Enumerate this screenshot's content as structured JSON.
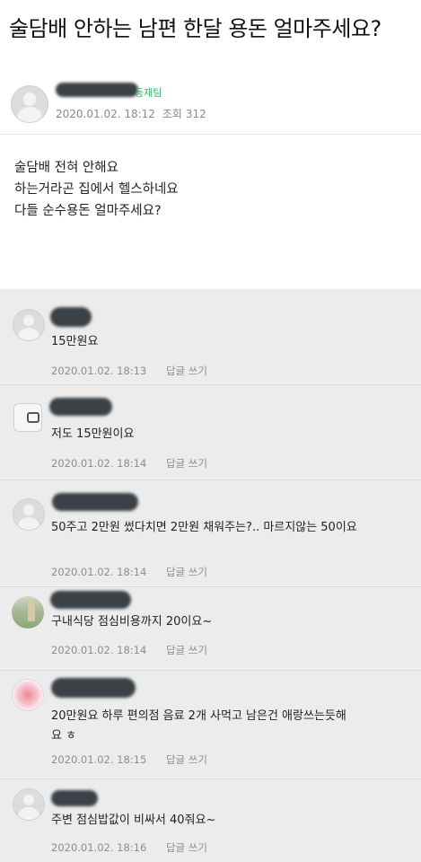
{
  "post": {
    "title": "술담배 안하는 남편 한달 용돈 얼마주세요?",
    "author_grade": "등재팀",
    "date": "2020.01.02. 18:12",
    "views_label": "조회",
    "views": "312",
    "content": [
      "술담배 전혀 안해요",
      "하는거라곤 집에서 헬스하네요",
      "다들 순수용돈 얼마주세요?"
    ]
  },
  "comments": [
    {
      "text": "15만원요",
      "date": "2020.01.02. 18:13",
      "reply": "답글 쓰기"
    },
    {
      "text": "저도 15만원이요",
      "date": "2020.01.02. 18:14",
      "reply": "답글 쓰기"
    },
    {
      "text": "50주고 2만원 썼다치면 2만원 채워주는?.. 마르지않는 50이요",
      "date": "2020.01.02. 18:14",
      "reply": "답글 쓰기"
    },
    {
      "text": "구내식당 점심비용까지 20이요~",
      "date": "2020.01.02. 18:14",
      "reply": "답글 쓰기"
    },
    {
      "text": "20만원요 하루 편의점 음료 2개 사먹고 남은건 애랑쓰는듯해요 ㅎ",
      "date": "2020.01.02. 18:15",
      "reply": "답글 쓰기"
    },
    {
      "text": "주변 점심밥값이 비싸서 40줘요~",
      "date": "2020.01.02. 18:16",
      "reply": "답글 쓰기"
    }
  ]
}
